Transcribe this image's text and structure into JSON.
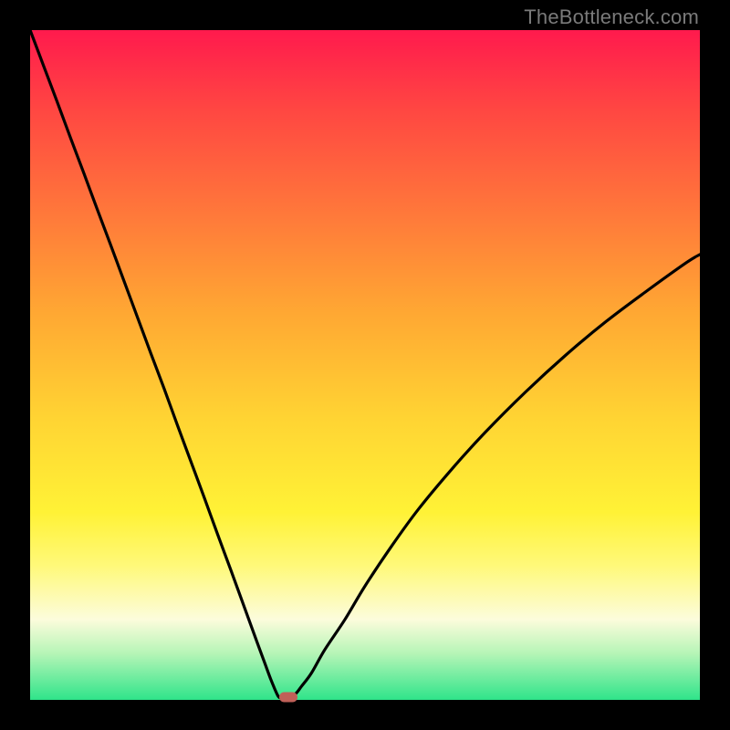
{
  "watermark": "TheBottleneck.com",
  "colors": {
    "frame": "#000000",
    "curve": "#000000",
    "marker": "#c06058"
  },
  "chart_data": {
    "type": "line",
    "title": "",
    "xlabel": "",
    "ylabel": "",
    "xlim": [
      0,
      100
    ],
    "ylim": [
      0,
      100
    ],
    "x": [
      0,
      2,
      4,
      6,
      8,
      10,
      12,
      14,
      16,
      18,
      20,
      22,
      24,
      26,
      28,
      30,
      32,
      34,
      35,
      36,
      37,
      37.5,
      38,
      39.5,
      40.5,
      42,
      44,
      47,
      50,
      54,
      58,
      63,
      68,
      74,
      80,
      86,
      92,
      98,
      100
    ],
    "values": [
      100,
      94.7,
      89.4,
      84.0,
      78.7,
      73.3,
      68.0,
      62.6,
      57.2,
      51.8,
      46.5,
      41.0,
      35.6,
      30.2,
      24.7,
      19.3,
      13.8,
      8.3,
      5.6,
      2.9,
      0.6,
      0.3,
      0.3,
      0.8,
      2.0,
      4.0,
      7.5,
      12.0,
      17.0,
      23.0,
      28.5,
      34.5,
      40.0,
      46.0,
      51.5,
      56.5,
      61.0,
      65.3,
      66.5
    ],
    "marker": {
      "x": 38.5,
      "y": 0.4
    },
    "gradient_stops": [
      {
        "pos": 0.0,
        "color": "#ff1a4d"
      },
      {
        "pos": 0.12,
        "color": "#ff4742"
      },
      {
        "pos": 0.28,
        "color": "#ff7a3a"
      },
      {
        "pos": 0.42,
        "color": "#ffa733"
      },
      {
        "pos": 0.58,
        "color": "#ffd433"
      },
      {
        "pos": 0.72,
        "color": "#fff236"
      },
      {
        "pos": 0.8,
        "color": "#fff97a"
      },
      {
        "pos": 0.88,
        "color": "#fcfcdc"
      },
      {
        "pos": 0.93,
        "color": "#b7f5b7"
      },
      {
        "pos": 1.0,
        "color": "#2fe48a"
      }
    ]
  }
}
